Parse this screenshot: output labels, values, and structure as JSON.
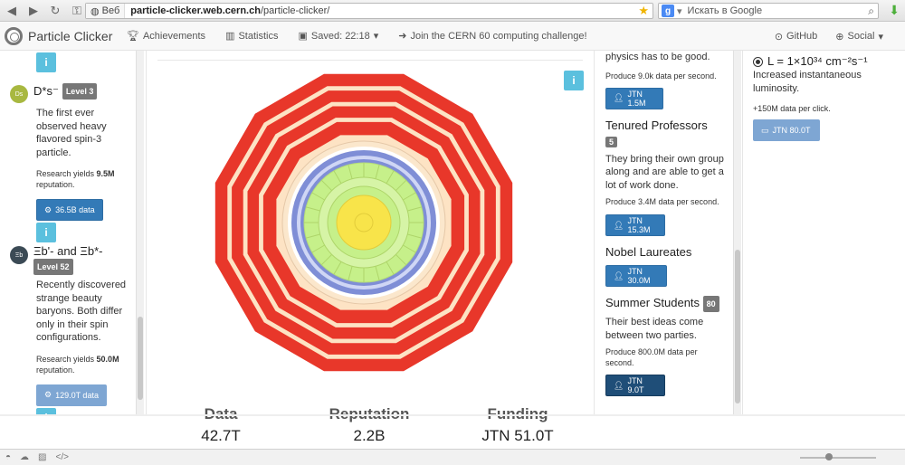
{
  "browser": {
    "tab_chip": "Веб",
    "url_domain": "particle-clicker.web.cern.ch",
    "url_path": "/particle-clicker/",
    "search_placeholder": "Искать в Google"
  },
  "navbar": {
    "brand": "Particle Clicker",
    "achievements": "Achievements",
    "statistics": "Statistics",
    "saved": "Saved: 22:18",
    "challenge": "Join the CERN 60 computing challenge!",
    "github": "GitHub",
    "social": "Social"
  },
  "research": [
    {
      "symbol": "D*s⁻",
      "icon_text": "Ds",
      "level": "Level 3",
      "description": "The first ever observed heavy flavored spin-3 particle.",
      "yield_prefix": "Research yields",
      "yield_value": "9.5M",
      "yield_suffix": "reputation.",
      "cost": "36.5B data",
      "icon_color": "#a8b840"
    },
    {
      "symbol": "Ξb'- and Ξb*-",
      "icon_text": "Ξb",
      "level": "Level 52",
      "description": "Recently discovered strange beauty baryons. Both differ only in their spin configurations.",
      "yield_prefix": "Research yields",
      "yield_value": "50.0M",
      "yield_suffix": "reputation.",
      "cost": "129.0T data",
      "icon_color": "#3b4a55"
    }
  ],
  "info_label": "i",
  "workers": {
    "top_desc": "physics has to be good.",
    "top_prod": "Produce 9.0k data per second.",
    "top_cost": "JTN 1.5M",
    "items": [
      {
        "title": "Tenured Professors",
        "count": "5",
        "description": "They bring their own group along and are able to get a lot of work done.",
        "prod": "Produce 3.4M data per second.",
        "cost": "JTN 15.3M"
      },
      {
        "title": "Nobel Laureates",
        "count": "",
        "description": "",
        "prod": "",
        "cost": "JTN 30.0M"
      },
      {
        "title": "Summer Students",
        "count": "80",
        "description": "Their best ideas come between two parties.",
        "prod": "Produce 800.0M data per second.",
        "cost": "JTN 9.0T"
      }
    ]
  },
  "upgrade": {
    "title": "L = 1×10³⁴ cm⁻²s⁻¹",
    "description": "Increased instantaneous luminosity.",
    "effect": "+150M data per click.",
    "cost": "JTN 80.0T"
  },
  "stats": {
    "data_label": "Data",
    "data_value": "42.7T",
    "reputation_label": "Reputation",
    "reputation_value": "2.2B",
    "funding_label": "Funding",
    "funding_value": "JTN 51.0T"
  },
  "colors": {
    "accent": "#337ab7",
    "info": "#5bc0de",
    "detector_red": "#e8372a",
    "detector_cream": "#fde3c4",
    "detector_blue": "#7f8ed6",
    "detector_green": "#c6f08a",
    "detector_core": "#f8e44a"
  }
}
